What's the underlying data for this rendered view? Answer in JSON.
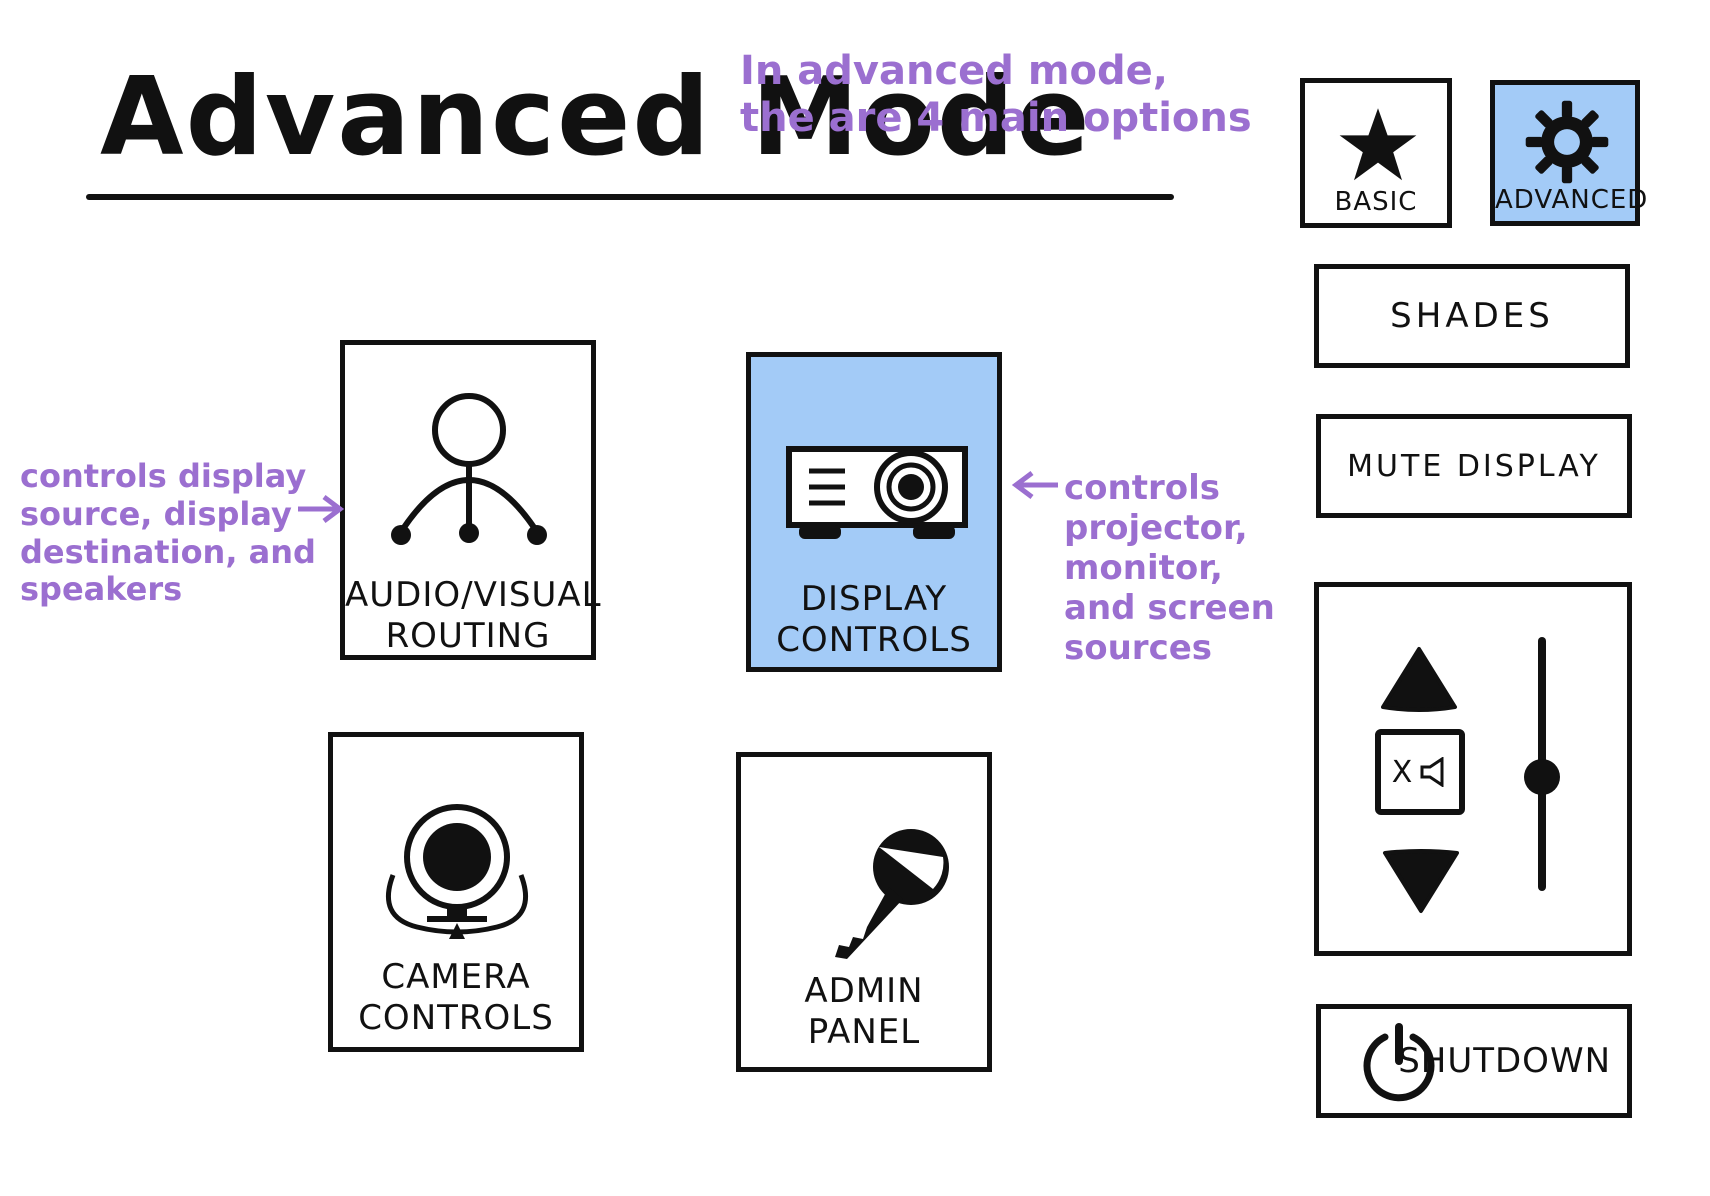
{
  "header": {
    "title": "Advanced Mode",
    "note": "In advanced mode,\nthe are 4 main options"
  },
  "mode_toggle": {
    "basic_label": "BASIC",
    "advanced_label": "ADVANCED",
    "active": "advanced"
  },
  "tiles": {
    "av_routing": "AUDIO/VISUAL\nROUTING",
    "display_controls": "DISPLAY\nCONTROLS",
    "camera_controls": "CAMERA\nCONTROLS",
    "admin_panel": "ADMIN\nPANEL"
  },
  "annotations": {
    "av_note": "controls display\nsource, display\ndestination, and\nspeakers",
    "display_note": "controls\nprojector,\nmonitor,\nand screen\nsources"
  },
  "right_panel": {
    "shades_label": "SHADES",
    "mute_display_label": "MUTE DISPLAY",
    "mute_audio_glyph": "X",
    "volume_level": 0.45,
    "shutdown_label": "SHUTDOWN"
  },
  "colors": {
    "accent": "#a3cbf7",
    "ink": "#111111",
    "note": "#9b6fd0"
  },
  "icons": [
    "star-icon",
    "gear-icon",
    "person-routing-icon",
    "projector-icon",
    "webcam-icon",
    "key-icon",
    "volume-up-icon",
    "volume-down-icon",
    "mute-icon",
    "power-icon"
  ]
}
